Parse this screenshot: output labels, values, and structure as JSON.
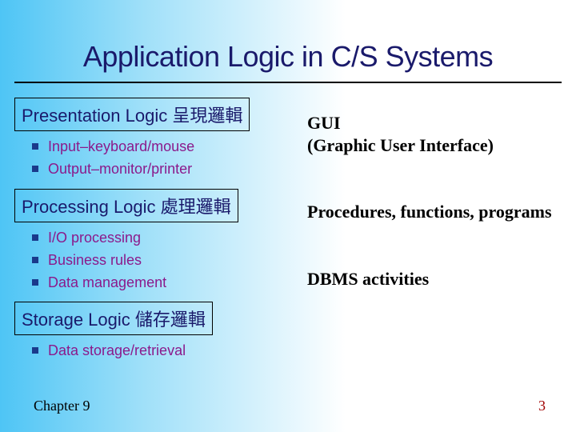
{
  "title": "Application Logic in C/S Systems",
  "sections": [
    {
      "header_en": "Presentation Logic ",
      "header_cjk": "呈現邏輯",
      "bullets": [
        "Input–keyboard/mouse",
        "Output–monitor/printer"
      ],
      "annotation": "GUI\n(Graphic User Interface)"
    },
    {
      "header_en": "Processing Logic ",
      "header_cjk": "處理邏輯",
      "bullets": [
        "I/O processing",
        "Business rules",
        "Data management"
      ],
      "annotation": "Procedures, functions, programs"
    },
    {
      "header_en": "Storage Logic ",
      "header_cjk": "儲存邏輯",
      "bullets": [
        "Data storage/retrieval"
      ],
      "annotation": "DBMS activities"
    }
  ],
  "footer_left": "Chapter 9",
  "footer_right": "3"
}
